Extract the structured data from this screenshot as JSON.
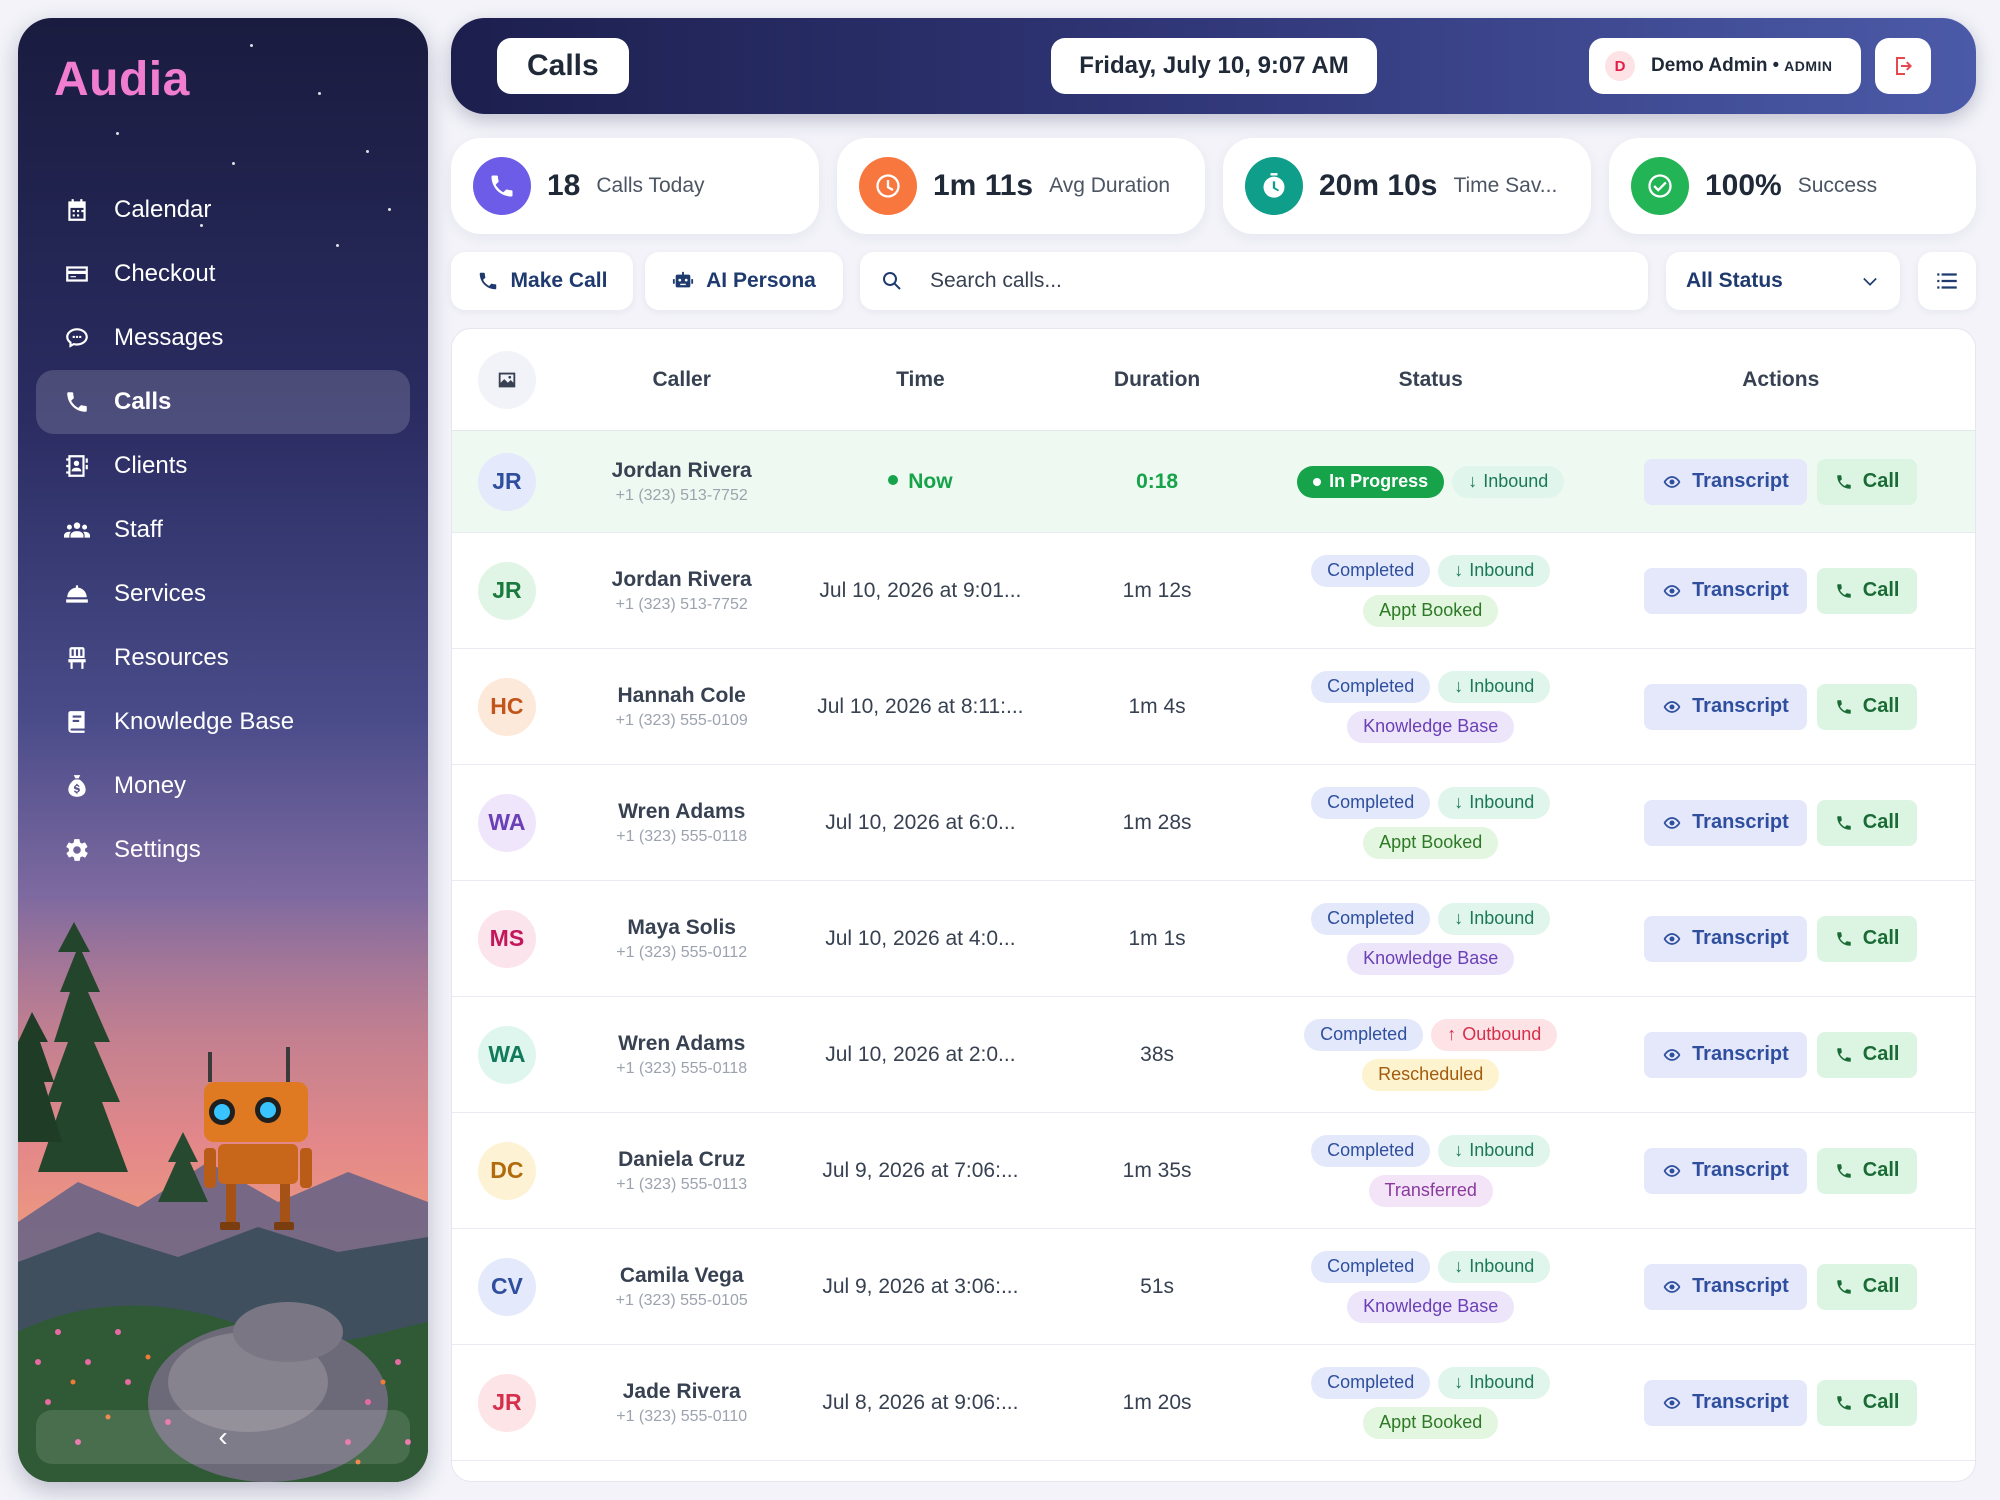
{
  "app": {
    "brand": "Audia"
  },
  "sidebar": {
    "items": [
      {
        "label": "Calendar",
        "icon": "calendar-icon",
        "active": false
      },
      {
        "label": "Checkout",
        "icon": "credit-card-icon",
        "active": false
      },
      {
        "label": "Messages",
        "icon": "chat-bubble-icon",
        "active": false
      },
      {
        "label": "Calls",
        "icon": "phone-icon",
        "active": true
      },
      {
        "label": "Clients",
        "icon": "contact-card-icon",
        "active": false
      },
      {
        "label": "Staff",
        "icon": "users-icon",
        "active": false
      },
      {
        "label": "Services",
        "icon": "service-bell-icon",
        "active": false
      },
      {
        "label": "Resources",
        "icon": "chair-icon",
        "active": false
      },
      {
        "label": "Knowledge Base",
        "icon": "book-icon",
        "active": false
      },
      {
        "label": "Money",
        "icon": "money-bag-icon",
        "active": false
      },
      {
        "label": "Settings",
        "icon": "gear-icon",
        "active": false
      }
    ],
    "collapse_glyph": "‹"
  },
  "header": {
    "title": "Calls",
    "datetime": "Friday, July 10, 9:07 AM",
    "user": {
      "initial": "D",
      "name": "Demo Admin",
      "separator": "•",
      "role": "ADMIN"
    }
  },
  "stats": [
    {
      "value": "18",
      "label": "Calls Today",
      "color": "#6d5ce8",
      "icon": "phone-icon"
    },
    {
      "value": "1m 11s",
      "label": "Avg Duration",
      "color": "#f7773f",
      "icon": "clock-icon"
    },
    {
      "value": "20m 10s",
      "label": "Time Sav...",
      "color": "#0f9e8a",
      "icon": "stopwatch-icon"
    },
    {
      "value": "100%",
      "label": "Success",
      "color": "#22b455",
      "icon": "check-circle-icon"
    }
  ],
  "toolbar": {
    "make_call": "Make Call",
    "ai_persona": "AI Persona",
    "search_placeholder": "Search calls...",
    "status_filter": "All Status"
  },
  "table": {
    "columns": [
      "Caller",
      "Time",
      "Duration",
      "Status",
      "Actions"
    ],
    "action_transcript": "Transcript",
    "action_call": "Call",
    "rows": [
      {
        "initials": "JR",
        "av_bg": "#e4e9fb",
        "av_fg": "#2f4f9e",
        "name": "Jordan Rivera",
        "phone": "+1 (323) 513-7752",
        "time": "Now",
        "duration": "0:18",
        "live": true,
        "status": "In Progress",
        "direction": "Inbound",
        "outcome": ""
      },
      {
        "initials": "JR",
        "av_bg": "#e1f5e6",
        "av_fg": "#1b7a3e",
        "name": "Jordan Rivera",
        "phone": "+1 (323) 513-7752",
        "time": "Jul 10, 2026 at 9:01...",
        "duration": "1m 12s",
        "live": false,
        "status": "Completed",
        "direction": "Inbound",
        "outcome": "Appt Booked"
      },
      {
        "initials": "HC",
        "av_bg": "#fde9da",
        "av_fg": "#c2551a",
        "name": "Hannah Cole",
        "phone": "+1 (323) 555-0109",
        "time": "Jul 10, 2026 at 8:11:...",
        "duration": "1m 4s",
        "live": false,
        "status": "Completed",
        "direction": "Inbound",
        "outcome": "Knowledge Base"
      },
      {
        "initials": "WA",
        "av_bg": "#efe6fb",
        "av_fg": "#6b3fb6",
        "name": "Wren Adams",
        "phone": "+1 (323) 555-0118",
        "time": "Jul 10, 2026 at 6:0...",
        "duration": "1m 28s",
        "live": false,
        "status": "Completed",
        "direction": "Inbound",
        "outcome": "Appt Booked"
      },
      {
        "initials": "MS",
        "av_bg": "#fce4ec",
        "av_fg": "#c2185b",
        "name": "Maya Solis",
        "phone": "+1 (323) 555-0112",
        "time": "Jul 10, 2026 at 4:0...",
        "duration": "1m 1s",
        "live": false,
        "status": "Completed",
        "direction": "Inbound",
        "outcome": "Knowledge Base"
      },
      {
        "initials": "WA",
        "av_bg": "#dff6ee",
        "av_fg": "#117a5a",
        "name": "Wren Adams",
        "phone": "+1 (323) 555-0118",
        "time": "Jul 10, 2026 at 2:0...",
        "duration": "38s",
        "live": false,
        "status": "Completed",
        "direction": "Outbound",
        "outcome": "Rescheduled"
      },
      {
        "initials": "DC",
        "av_bg": "#fdf2d4",
        "av_fg": "#b16a0c",
        "name": "Daniela Cruz",
        "phone": "+1 (323) 555-0113",
        "time": "Jul 9, 2026 at 7:06:...",
        "duration": "1m 35s",
        "live": false,
        "status": "Completed",
        "direction": "Inbound",
        "outcome": "Transferred"
      },
      {
        "initials": "CV",
        "av_bg": "#e4e9fb",
        "av_fg": "#2f4f9e",
        "name": "Camila Vega",
        "phone": "+1 (323) 555-0105",
        "time": "Jul 9, 2026 at 3:06:...",
        "duration": "51s",
        "live": false,
        "status": "Completed",
        "direction": "Inbound",
        "outcome": "Knowledge Base"
      },
      {
        "initials": "JR",
        "av_bg": "#fde4e6",
        "av_fg": "#d62f4b",
        "name": "Jade Rivera",
        "phone": "+1 (323) 555-0110",
        "time": "Jul 8, 2026 at 9:06:...",
        "duration": "1m 20s",
        "live": false,
        "status": "Completed",
        "direction": "Inbound",
        "outcome": "Appt Booked"
      }
    ]
  }
}
